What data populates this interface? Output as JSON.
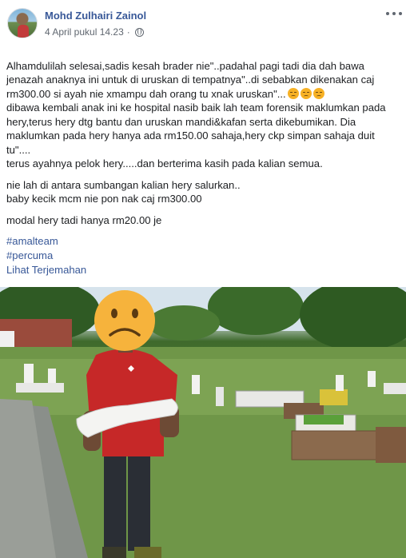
{
  "post": {
    "author": "Mohd Zulhairi Zainol",
    "timestamp": "4 April pukul 14.23",
    "separator": "·",
    "privacy_icon": "globe-icon",
    "menu_icon": "more-options-icon",
    "paragraphs": [
      "Alhamdulilah selesai,sadis kesah brader nie\"..padahal pagi tadi dia dah bawa jenazah anaknya ini untuk di uruskan di tempatnya\"..di sebabkan dikenakan caj rm300.00 si ayah nie xmampu dah orang tu xnak uruskan\"...",
      "dibawa kembali anak ini ke hospital nasib baik lah team forensik maklumkan pada hery,terus hery dtg bantu dan uruskan mandi&kafan serta dikebumikan. Dia maklumkan pada hery hanya ada rm150.00 sahaja,hery ckp simpan sahaja duit tu\"....",
      "terus ayahnya pelok hery.....dan berterima kasih pada kalian semua.",
      "nie lah di antara sumbangan kalian hery salurkan..",
      "baby kecik mcm nie pon nak caj rm300.00",
      "modal hery tadi hanya rm20.00 je"
    ],
    "hashtags": [
      "#amalteam",
      "#percuma"
    ],
    "translate_link": "Lihat Terjemahan",
    "emojis": [
      "pensive-face-icon",
      "pensive-face-icon",
      "pensive-face-icon"
    ],
    "photo_description_icon": "sad-face-icon"
  },
  "colors": {
    "link": "#385898",
    "text": "#1c1e21",
    "meta": "#606770",
    "shirt": "#c62828",
    "emoji": "#f7b125"
  }
}
